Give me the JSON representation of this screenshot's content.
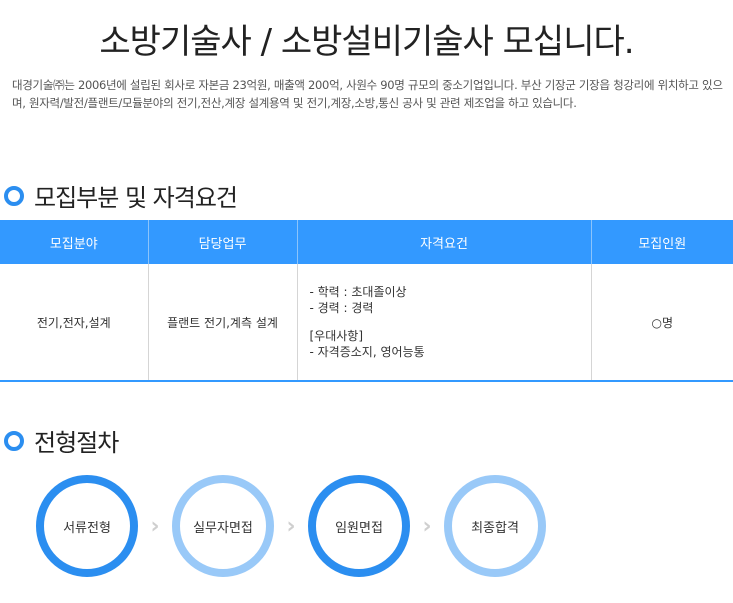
{
  "header": {
    "title": "소방기술사 / 소방설비기술사 모십니다.",
    "intro": "대경기술㈜는 2006년에 설립된 회사로 자본금 23억원, 매출액 200억, 사원수 90명 규모의 중소기업입니다. 부산 기장군 기장읍 청강리에 위치하고 있으며, 원자력/발전/플랜트/모듈분야의 전기,전산,계장 설계용역 및 전기,계장,소방,통신 공사 및 관련 제조업을 하고 있습니다."
  },
  "requirements": {
    "section_title": "모집부분 및 자격요건",
    "columns": [
      "모집분야",
      "담당업무",
      "자격요건",
      "모집인원"
    ],
    "row": {
      "field": "전기,전자,설계",
      "duty": "플랜트 전기,계측 설계",
      "qualifications": [
        "- 학력 : 초대졸이상",
        "- 경력 : 경력"
      ],
      "preference_title": "[우대사항]",
      "preferences": [
        "- 자격증소지, 영어능통"
      ],
      "headcount": "○명"
    }
  },
  "process": {
    "section_title": "전형절차",
    "steps": [
      "서류전형",
      "실무자면접",
      "임원면접",
      "최종합격"
    ],
    "arrow": "›"
  },
  "colors": {
    "accent": "#3399ff",
    "ring": "#2b8ef0",
    "ring_light": "#99c9f8"
  },
  "icons": [
    "ring-bullet-icon",
    "chevron-right-icon"
  ]
}
